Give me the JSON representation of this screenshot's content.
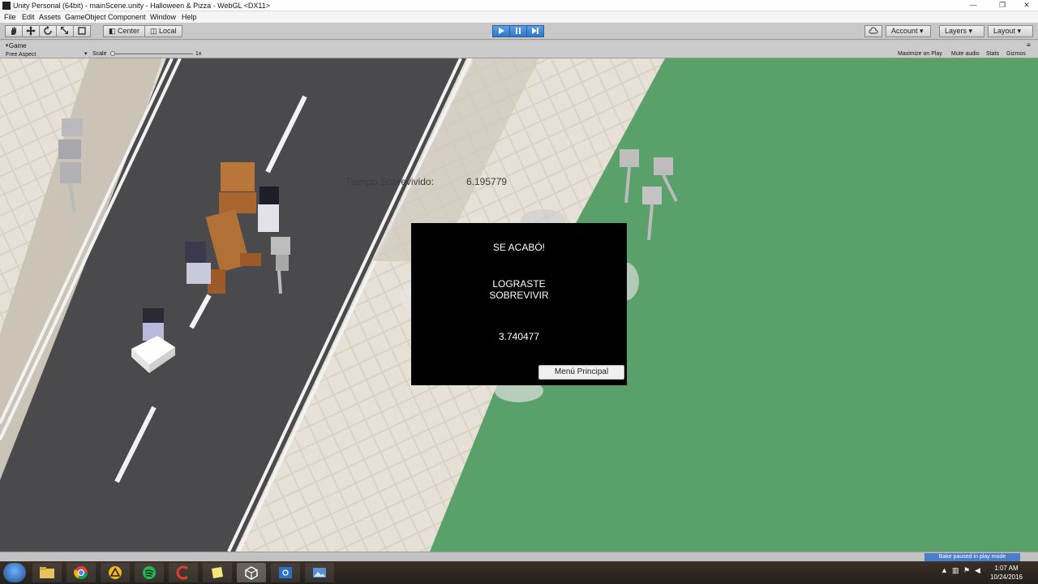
{
  "window": {
    "title": "Unity Personal (64bit) - mainScene.unity - Halloween & Pizza - WebGL <DX11>",
    "controls": [
      "—",
      "❐",
      "✕"
    ]
  },
  "menubar": {
    "items": [
      "File",
      "Edit",
      "Assets",
      "GameObject",
      "Component",
      "Window",
      "Help"
    ]
  },
  "toolbar": {
    "tools": [
      "hand",
      "move",
      "rotate",
      "scale",
      "rect"
    ],
    "pivot_label": "Center",
    "space_label": "Local",
    "play_icon": "play-icon",
    "pause_icon": "pause-icon",
    "step_icon": "step-icon",
    "account_label": "Account",
    "layers_label": "Layers",
    "layout_label": "Layout",
    "dropdown_arrow": "▾"
  },
  "game_view": {
    "tab_label": "Game",
    "aspect_label": "Free Aspect",
    "scale_label": "Scale",
    "scale_value": "1x",
    "maximize_label": "Maximize on Play",
    "mute_label": "Mute audio",
    "stats_label": "Stats",
    "gizmos_label": "Gizmos"
  },
  "hud": {
    "time_label": "Tiempo Sobrevivido:",
    "time_value": "6.195779"
  },
  "gameover_panel": {
    "title": "SE ACABÓ!",
    "message_line1": "LOGRASTE",
    "message_line2": "SOBREVIVIR",
    "score": "3.740477",
    "button_label": "Menú Principal"
  },
  "statusbar": {
    "bake_text": "Bake paused in play mode"
  },
  "taskbar": {
    "apps": [
      "file-explorer-icon",
      "chrome-icon",
      "app-icon",
      "spotify-icon",
      "ccleaner-icon",
      "sticky-notes-icon",
      "unity-icon",
      "screen-capture-icon",
      "photos-icon"
    ],
    "clock_time": "1:07 AM",
    "clock_date": "10/24/2016"
  },
  "colors": {
    "grass": "#5aa06a",
    "asphalt": "#4a4a4c",
    "play_active": "#2f76c8",
    "panel_bg": "#000000"
  }
}
